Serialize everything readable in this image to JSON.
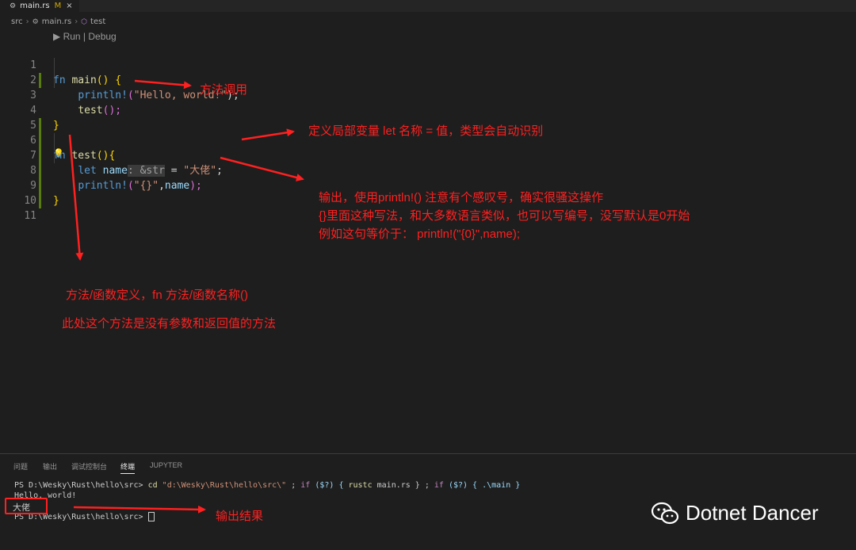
{
  "tab": {
    "icon": "rust-gear-icon",
    "filename": "main.rs",
    "modified": "M",
    "close": "×"
  },
  "breadcrumb": {
    "folder": "src",
    "file": "main.rs",
    "symbol": "test"
  },
  "codelens": "▶ Run | Debug",
  "line_numbers": [
    "1",
    "2",
    "3",
    "4",
    "5",
    "6",
    "7",
    "8",
    "9",
    "10",
    "11"
  ],
  "code": {
    "l1": {
      "kw": "fn",
      "name": "main",
      "rest": "() {"
    },
    "l2": {
      "mac": "println!",
      "open": "(",
      "str": "\"Hello, world!\"",
      "close": ");"
    },
    "l3": {
      "call": "test",
      "rest": "();"
    },
    "l4": "}",
    "l6": {
      "kw": "fn",
      "name": "test",
      "rest": "(){"
    },
    "l7": {
      "kw": "let",
      "var": "name",
      "hint": ": &str",
      "eq": " = ",
      "str": "\"大佬\"",
      "end": ";"
    },
    "l8": {
      "mac": "println!",
      "open": "(",
      "str": "\"{}\"",
      "mid": ",",
      "var": "name",
      "close": ");"
    },
    "l9": "}"
  },
  "annotations": {
    "call": "方法调用",
    "define": "定义局部变量  let 名称 = 值，类型会自动识别",
    "output1": "输出，使用println!()  注意有个感叹号，确实很骚这操作",
    "output2": "{}里面这种写法，和大多数语言类似，也可以写编号，没写默认是0开始",
    "output3": "例如这句等价于：  println!(\"{0}\",name);",
    "func1": "方法/函数定义，fn 方法/函数名称()",
    "func2": "此处这个方法是没有参数和返回值的方法",
    "result": "输出结果"
  },
  "panel_tabs": [
    "问题",
    "输出",
    "调试控制台",
    "终端",
    "JUPYTER"
  ],
  "active_panel_tab": "终端",
  "terminal": {
    "prompt": "PS D:\\Wesky\\Rust\\hello\\src>",
    "cmd": "cd",
    "path": "\"d:\\Wesky\\Rust\\hello\\src\\\"",
    "sep1": " ; ",
    "if1": "if",
    "cond1": " ($?) { ",
    "rustc": "rustc",
    "arg": " main.rs } ; ",
    "if2": "if",
    "cond2": " ($?) { .\\main }",
    "out1": "Hello, world!",
    "out2": "大佬",
    "prompt2": "PS D:\\Wesky\\Rust\\hello\\src>"
  },
  "watermark": {
    "icon": "wechat-icon",
    "text": "Dotnet Dancer"
  },
  "colors": {
    "annotation": "#ff2020",
    "background": "#1e1e1e",
    "gutter_modified": "#587c0c"
  }
}
